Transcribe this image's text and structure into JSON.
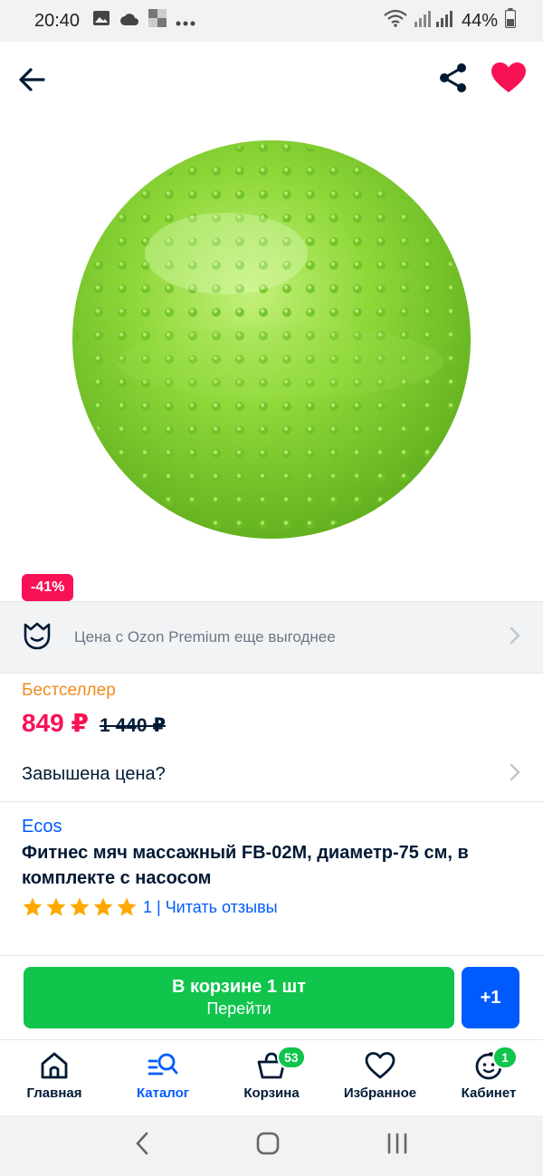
{
  "status_bar": {
    "time": "20:40",
    "battery": "44%"
  },
  "product": {
    "discount_badge": "-41%",
    "premium_text": "Цена с Ozon Premium еще выгоднее",
    "bestseller": "Бестселлер",
    "price_now": "849 ₽",
    "price_old": "1 440 ₽",
    "overprice_label": "Завышена цена?",
    "brand": "Ecos",
    "title": "Фитнес мяч массажный FB-02M, диаметр-75 см, в комплекте с насосом",
    "rating_stars": 5,
    "rating_text": "1 | Читать отзывы"
  },
  "cart": {
    "button_main": "В корзине 1 шт",
    "button_sub": "Перейти",
    "plus_label": "+1"
  },
  "bottom_nav": {
    "items": [
      {
        "label": "Главная",
        "icon": "home-icon"
      },
      {
        "label": "Каталог",
        "icon": "catalog-search-icon"
      },
      {
        "label": "Корзина",
        "icon": "basket-icon",
        "badge": "53"
      },
      {
        "label": "Избранное",
        "icon": "heart-outline-icon"
      },
      {
        "label": "Кабинет",
        "icon": "profile-face-icon",
        "badge": "1"
      }
    ]
  },
  "colors": {
    "accent": "#005bff",
    "sale": "#f91155",
    "cart_green": "#10c44c",
    "bestseller": "#f08c1e",
    "favorite": "#f91155"
  }
}
